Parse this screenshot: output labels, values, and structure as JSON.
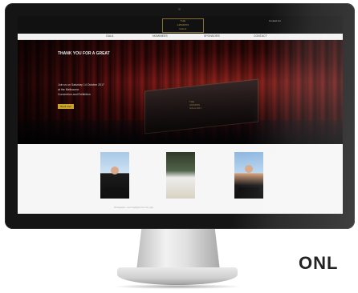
{
  "site": {
    "logo_lines": [
      "THE",
      "AWARDS",
      "GALA"
    ],
    "header_right": "Contact Us",
    "nav": [
      "Gala",
      "Nominees",
      "Sponsors",
      "Contact"
    ],
    "hero": {
      "title": "THANK YOU FOR A GREAT",
      "lines": [
        "Join us on Saturday 14 October 2017",
        "at the Melbourne",
        "Convention and Exhibition"
      ],
      "button": "Book now"
    },
    "stage_lines": [
      "THE",
      "AWARDS",
      "GALA 2017"
    ],
    "caption": "Photography: event highlights from the night"
  },
  "side_text": "ONL",
  "colors": {
    "bezel": "#151515",
    "accent_gold": "#c9a227",
    "curtain_red": "#7a1414"
  }
}
